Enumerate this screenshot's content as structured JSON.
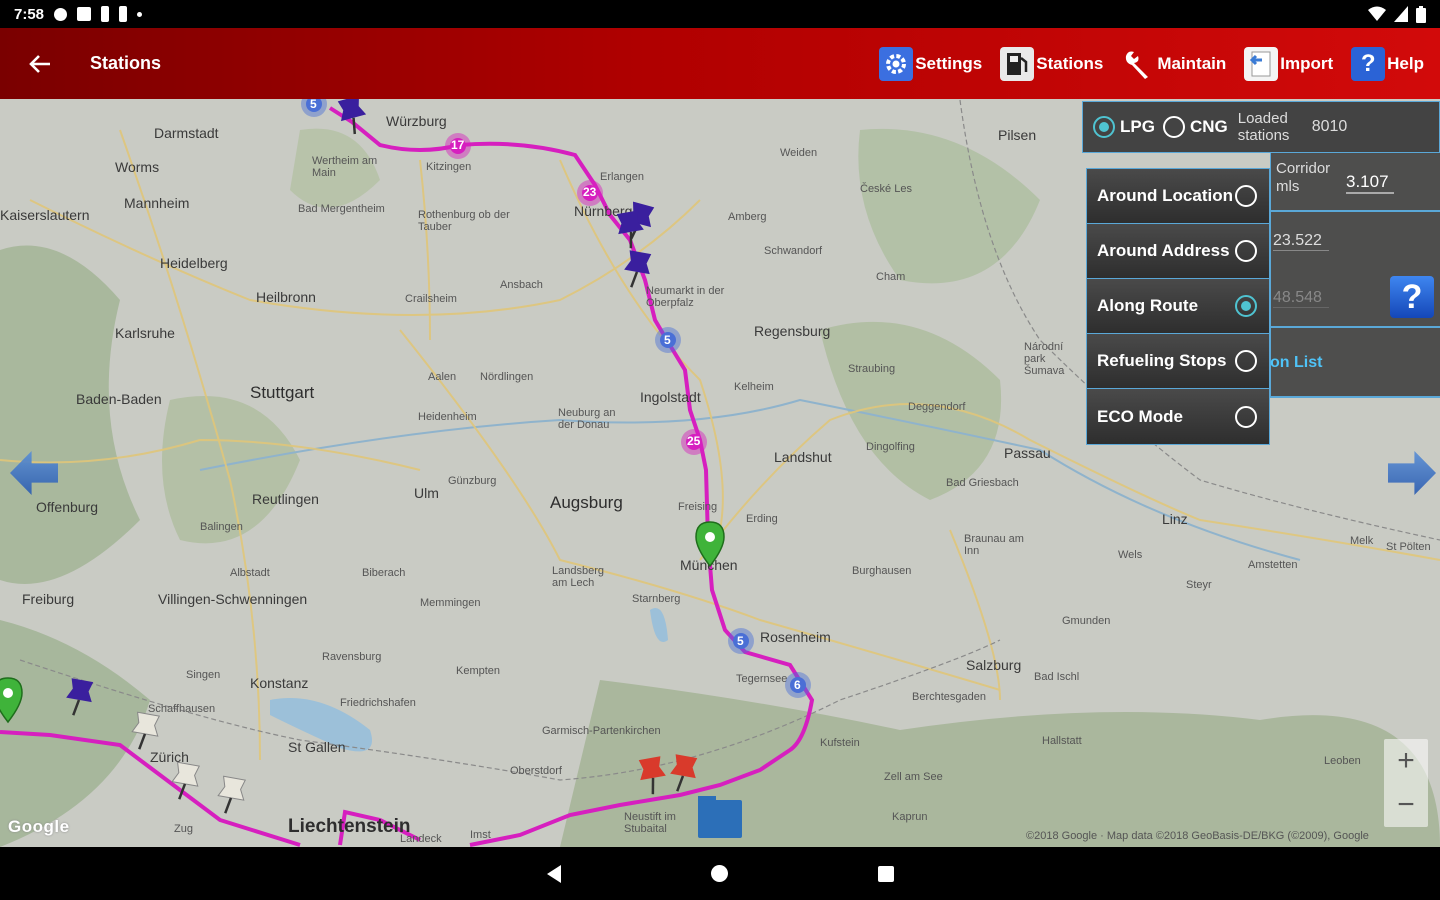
{
  "status_bar": {
    "time": "7:58"
  },
  "app_bar": {
    "title": "Stations",
    "actions": [
      {
        "id": "settings",
        "label": "Settings",
        "icon": "gear-icon"
      },
      {
        "id": "stations",
        "label": "Stations",
        "icon": "fuel-pump-icon"
      },
      {
        "id": "maintain",
        "label": "Maintain",
        "icon": "wrench-icon"
      },
      {
        "id": "import",
        "label": "Import",
        "icon": "import-icon"
      },
      {
        "id": "help",
        "label": "Help",
        "icon": "question-icon"
      }
    ]
  },
  "panel": {
    "fuel_options": [
      {
        "label": "LPG",
        "selected": true
      },
      {
        "label": "CNG",
        "selected": false
      }
    ],
    "loaded_label": "Loaded stations",
    "loaded_value": "8010",
    "corridor_label": "Corridor mls",
    "corridor_value": "3.107",
    "value_2": "23.522",
    "value_3": "48.548",
    "station_list_link": "on List",
    "search_modes": [
      {
        "label": "Around Location",
        "selected": false
      },
      {
        "label": "Around Address",
        "selected": false
      },
      {
        "label": "Along Route",
        "selected": true
      },
      {
        "label": "Refueling Stops",
        "selected": false
      },
      {
        "label": "ECO Mode",
        "selected": false
      }
    ],
    "help_symbol": "?"
  },
  "map": {
    "cities": {
      "darmstadt": "Darmstadt",
      "worms": "Worms",
      "mannheim": "Mannheim",
      "heidelberg": "Heidelberg",
      "kaiserslautern": "Kaiserslautern",
      "karlsruhe": "Karlsruhe",
      "heilbronn": "Heilbronn",
      "stuttgart": "Stuttgart",
      "baden_baden": "Baden-Baden",
      "offenburg": "Offenburg",
      "freiburg": "Freiburg",
      "reutlingen": "Reutlingen",
      "balingen": "Balingen",
      "albstadt": "Albstadt",
      "biberach": "Biberach",
      "villingen": "Villingen-Schwenningen",
      "ulm": "Ulm",
      "memmingen": "Memmingen",
      "kempten": "Kempten",
      "ravensburg": "Ravensburg",
      "konstanz": "Konstanz",
      "friedrichshafen": "Friedrichshafen",
      "singen": "Singen",
      "schaffhausen": "Schaffhausen",
      "zurich": "Zürich",
      "zug": "Zug",
      "st_gallen": "St Gallen",
      "liechtenstein": "Liechtenstein",
      "wurzburg": "Würzburg",
      "wertheim": "Wertheim am Main",
      "kitzingen": "Kitzingen",
      "bad_mergentheim": "Bad Mergentheim",
      "rothenburg": "Rothenburg ob der Tauber",
      "crailsheim": "Crailsheim",
      "ansbach": "Ansbach",
      "aalen": "Aalen",
      "nordlingen": "Nördlingen",
      "heidenheim": "Heidenheim",
      "gunzburg": "Günzburg",
      "augsburg": "Augsburg",
      "landsberg": "Landsberg am Lech",
      "starnberg": "Starnberg",
      "garmisch": "Garmisch-Partenkirchen",
      "neuburg": "Neuburg an der Donau",
      "ingolstadt": "Ingolstadt",
      "erlangen": "Erlangen",
      "nurnberg": "Nürnberg",
      "neumarkt": "Neumarkt in der Oberpfalz",
      "amberg": "Amberg",
      "weiden": "Weiden",
      "pilsen": "Pilsen",
      "schwandorf": "Schwandorf",
      "regensburg": "Regensburg",
      "kelheim": "Kelheim",
      "straubing": "Straubing",
      "cham": "Cham",
      "deggendorf": "Deggendorf",
      "landshut": "Landshut",
      "dingolfing": "Dingolfing",
      "passau": "Passau",
      "freising": "Freising",
      "erding": "Erding",
      "munich": "München",
      "rosenheim": "Rosenheim",
      "tegernsee": "Tegernsee",
      "kufstein": "Kufstein",
      "oberstdorf": "Oberstdorf",
      "salzburg": "Salzburg",
      "bad_ischl": "Bad Ischl",
      "linz": "Linz",
      "wels": "Wels",
      "steyr": "Steyr",
      "braunau": "Braunau am Inn",
      "gmunden": "Gmunden",
      "burghausen": "Burghausen",
      "bad_griesbach": "Bad Griesbach",
      "berchtesgaden": "Berchtesgaden",
      "hallstatt": "Hallstatt",
      "zell_am_see": "Zell am See",
      "kaprun": "Kaprun",
      "leoben": "Leoben",
      "amstetten": "Amstetten",
      "melk": "Melk",
      "st_polten": "St Pölten",
      "ceske": "České Les",
      "nardoni": "Národní park Šumava",
      "neustift": "Neustift im Stubaital",
      "imst": "Imst",
      "landeck": "Landeck"
    },
    "route_numbers": [
      "17",
      "23",
      "5",
      "25",
      "5",
      "6",
      "5"
    ],
    "google_label": "Google",
    "attribution": "©2018 Google · Map data ©2018 GeoBasis-DE/BKG (©2009), Google",
    "zoom_in": "+",
    "zoom_out": "−",
    "route_color": "#d61fbf",
    "pin_color_purple": "#3a1f9e",
    "pin_color_red": "#d93a2b",
    "pin_color_white": "#e8e6dc",
    "pin_color_green": "#3fb33a"
  }
}
